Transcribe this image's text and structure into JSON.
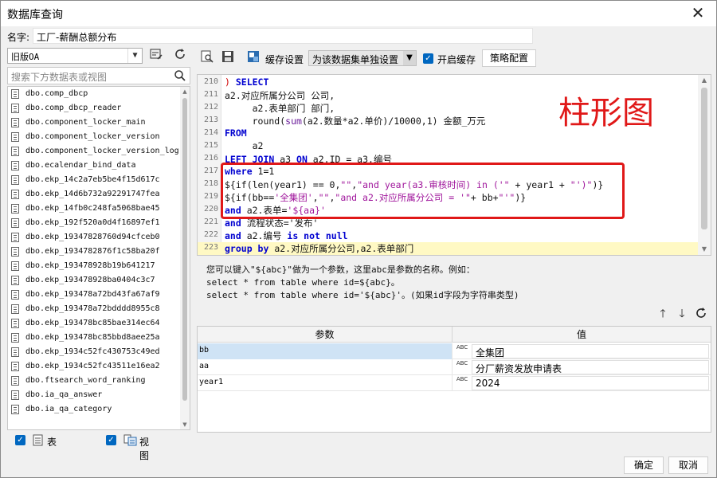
{
  "window": {
    "title": "数据库查询",
    "close_glyph": "✕"
  },
  "name_row": {
    "label": "名字:",
    "value": "工厂-薪酬总额分布"
  },
  "left": {
    "datasource": "旧版OA",
    "search_placeholder": "搜索下方数据表或视图",
    "tables": [
      "dbo.comp_dbcp",
      "dbo.comp_dbcp_reader",
      "dbo.component_locker_main",
      "dbo.component_locker_version",
      "dbo.component_locker_version_log",
      "dbo.ecalendar_bind_data",
      "dbo.ekp_14c2a7eb5be4f15d617c",
      "dbo.ekp_14d6b732a92291747fea",
      "dbo.ekp_14fb0c248fa5068bae45",
      "dbo.ekp_192f520a0d4f16897ef1",
      "dbo.ekp_19347828760d94cfceb0",
      "dbo.ekp_1934782876f1c58ba20f",
      "dbo.ekp_193478928b19b641217",
      "dbo.ekp_193478928ba0404c3c7",
      "dbo.ekp_193478a72bd43fa67af9",
      "dbo.ekp_193478a72bdddd8955c8",
      "dbo.ekp_193478bc85bae314ec64",
      "dbo.ekp_193478bc85bbd8aee25a",
      "dbo.ekp_1934c52fc430753c49ed",
      "dbo.ekp_1934c52fc43511e16ea2",
      "dbo.ftsearch_word_ranking",
      "dbo.ia_qa_answer",
      "dbo.ia_qa_category"
    ],
    "check_table_label": "表",
    "check_view_label": "视图"
  },
  "toolbar": {
    "cache_settings_label": "缓存设置",
    "cache_mode_value": "为该数据集单独设置",
    "enable_cache_label": "开启缓存",
    "strategy_button": "策略配置"
  },
  "editor": {
    "lines": [
      {
        "n": "210",
        "segs": [
          [
            "rd",
            ") "
          ],
          [
            "kw",
            "SELECT"
          ]
        ]
      },
      {
        "n": "211",
        "segs": [
          [
            "",
            "a2.对应所属分公司 公司,"
          ]
        ]
      },
      {
        "n": "212",
        "segs": [
          [
            "",
            "     a2.表单部门 部门,"
          ]
        ]
      },
      {
        "n": "213",
        "segs": [
          [
            "",
            "     round("
          ],
          [
            "fn",
            "sum"
          ],
          [
            "",
            "(a2.数量*a2.单价)/10000,1) 金额_万元"
          ]
        ]
      },
      {
        "n": "214",
        "segs": [
          [
            "kw",
            "FROM"
          ]
        ]
      },
      {
        "n": "215",
        "segs": [
          [
            "",
            "     a2"
          ]
        ]
      },
      {
        "n": "216",
        "segs": [
          [
            "kw",
            "LEFT JOIN"
          ],
          [
            "",
            " a3 "
          ],
          [
            "kw",
            "ON"
          ],
          [
            "",
            " a2.ID = a3.编号"
          ]
        ]
      },
      {
        "n": "217",
        "segs": [
          [
            "kw",
            "where"
          ],
          [
            "",
            " 1=1"
          ]
        ]
      },
      {
        "n": "218",
        "segs": [
          [
            "",
            "${if(len(year1) == 0,"
          ],
          [
            "str",
            "\"\""
          ],
          [
            "",
            ","
          ],
          [
            "str",
            "\"and year(a3.审核时间) in ('\""
          ],
          [
            "",
            " + year1 + "
          ],
          [
            "str",
            "\"')\""
          ],
          [
            "",
            ")}"
          ]
        ]
      },
      {
        "n": "219",
        "segs": [
          [
            "",
            "${if(bb=="
          ],
          [
            "str",
            "'全集团'"
          ],
          [
            "",
            ","
          ],
          [
            "str",
            "\"\""
          ],
          [
            "",
            ","
          ],
          [
            "str",
            "\"and a2.对应所属分公司 = '\""
          ],
          [
            "",
            "+ bb+"
          ],
          [
            "str",
            "\"'\""
          ],
          [
            "",
            ")}"
          ]
        ]
      },
      {
        "n": "220",
        "segs": [
          [
            "kw",
            "and"
          ],
          [
            "",
            " a2.表单="
          ],
          [
            "str",
            "'${aa}'"
          ]
        ]
      },
      {
        "n": "221",
        "segs": [
          [
            "kw",
            "and"
          ],
          [
            "",
            " 流程状态='发布'"
          ]
        ]
      },
      {
        "n": "222",
        "segs": [
          [
            "kw",
            "and"
          ],
          [
            "",
            " a2.编号 "
          ],
          [
            "kw",
            "is not null"
          ]
        ]
      },
      {
        "n": "223",
        "segs": [
          [
            "kw",
            "group by"
          ],
          [
            "",
            " a2.对应所属分公司,a2.表单部门"
          ]
        ],
        "highlight": true
      }
    ]
  },
  "annotation": {
    "text": "柱形图"
  },
  "help": {
    "line1": "您可以键入\"${abc}\"做为一个参数，这里abc是参数的名称。例如：",
    "line2": "select * from table where id=${abc}。",
    "line3": "select * from table where id='${abc}'。(如果id字段为字符串类型)"
  },
  "params": {
    "header_param": "参数",
    "header_value": "值",
    "rows": [
      {
        "name": "bb",
        "value": "全集团",
        "type_glyph": "ABC"
      },
      {
        "name": "aa",
        "value": "分厂薪资发放申请表",
        "type_glyph": "ABC"
      },
      {
        "name": "year1",
        "value": "2024",
        "type_glyph": "ABC"
      }
    ]
  },
  "footer": {
    "ok": "确定",
    "cancel": "取消"
  }
}
